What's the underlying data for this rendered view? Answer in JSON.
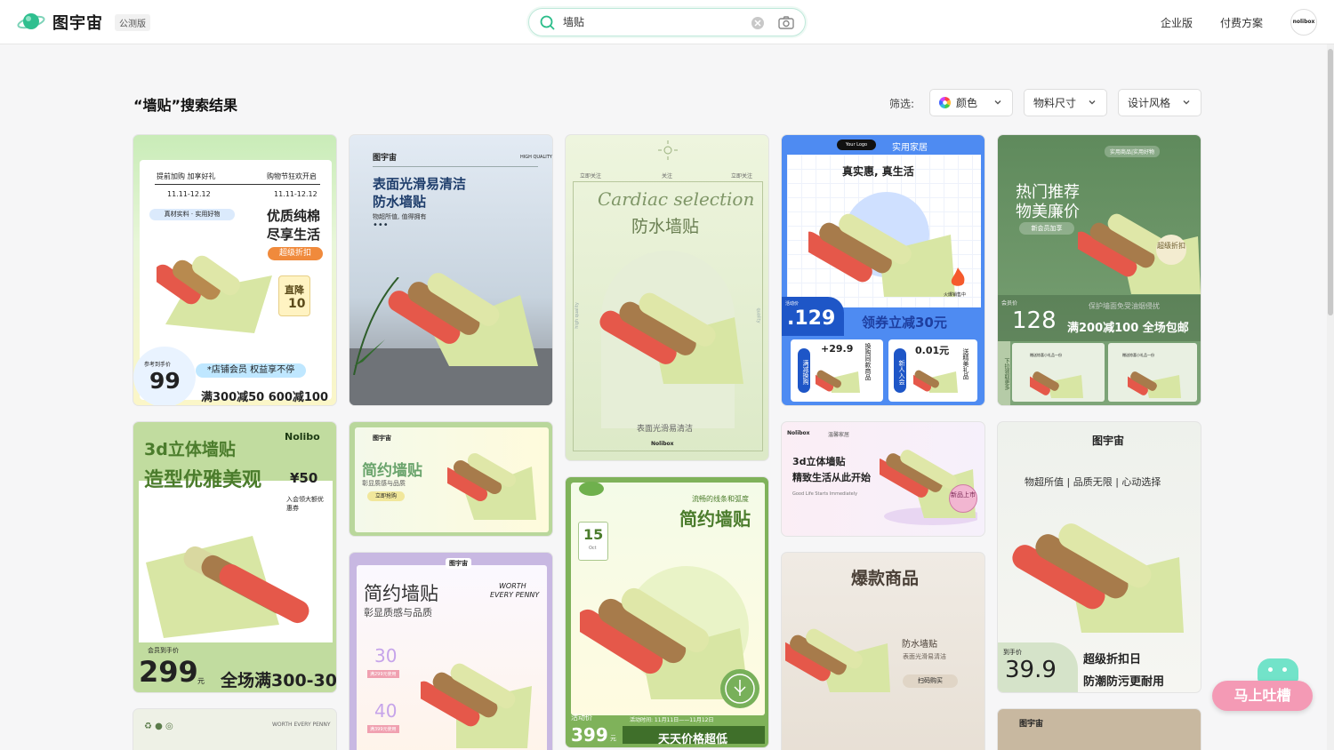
{
  "app": {
    "brand": "图宇宙",
    "badge": "公测版"
  },
  "search": {
    "value": "墙贴"
  },
  "nav": {
    "enterprise": "企业版",
    "pricing": "付费方案",
    "avatar": "nolibox"
  },
  "results": {
    "title": "“墙贴”搜索结果",
    "filter_label": "筛选:",
    "filters": [
      "颜色",
      "物料尺寸",
      "设计风格"
    ]
  },
  "colors": {
    "accent": "#2bbd8a",
    "feedback": "#f49ab5",
    "mascot": "#72e3c9"
  },
  "icons": [
    "planet-logo-icon",
    "search-icon",
    "clear-icon",
    "camera-icon",
    "color-wheel-icon",
    "chevron-down-icon",
    "mascot-icon"
  ],
  "cards": {
    "c1": {
      "t1": "提前加购 加享好礼",
      "t2": "购物节狂欢开启",
      "d1": "11.11-12.12",
      "d2": "11.11-12.12",
      "tag1": "真材实料",
      "tag2": "实用好物",
      "h1": "优质纯棉",
      "h2": "尽享生活",
      "badge": "超级折扣",
      "drop": "直降",
      "drop_val": "10",
      "ref": "参考到手价",
      "price": "99",
      "member": "*店铺会员 权益享不停",
      "promo": "满300减50 600减100"
    },
    "c2": {
      "logo": "图宇宙",
      "corner": "HIGH QUALITY",
      "h1": "表面光滑易清洁",
      "h2": "防水墙贴",
      "sub": "物超所值, 值得拥有",
      "dots": "•••"
    },
    "c3": {
      "n1": "立即关注",
      "n2": "关注",
      "n3": "立即关注",
      "script": "Cardiac selection",
      "h": "防水墙贴",
      "side1": "high quality",
      "side2": "quality",
      "foot": "表面光滑易清洁",
      "logo": "Nolibox"
    },
    "c4": {
      "logo": "Your Logo",
      "cat": "实用家居",
      "h": "真实惠, 真生活",
      "hot": "火爆销售中",
      "act": "活动价",
      "price": ".129",
      "coupon": "领券立减30元",
      "b1": "满减换购",
      "b1p": "+29.9",
      "b1s": "换购同款商品",
      "b2": "新人入会",
      "b2p": "0.01元",
      "b2s": "送精美礼品"
    },
    "c5": {
      "tags": "实用商品|实用好物",
      "h1": "热门推荐",
      "h2": "物美廉价",
      "new": "新会员加享",
      "badge": "超级折扣",
      "bar": "保护墙面免受油烟侵扰",
      "ref": "会员价",
      "price": "128",
      "promo": "满200减100 全场包邮",
      "side": "下拉领取更多",
      "g1": "赠送惊喜小礼品一份",
      "g2": "赠送惊喜小礼品一份"
    },
    "c6": {
      "h1": "3d立体墙贴",
      "h2": "造型优雅美观",
      "logo": "Nolibo",
      "coupon": "¥50",
      "coupon_sub": "入会领大额优惠券",
      "ref": "会员到手价",
      "price": "299",
      "unit": "元",
      "promo": "全场满300-30"
    },
    "c7": {
      "logo": "图宇宙",
      "h": "简约墙贴",
      "sub": "彰显质感与品质",
      "btn": "立即抢购"
    },
    "c8": {
      "logo": "图宇宙",
      "h": "简约墙贴",
      "sub": "彰显质感与品质",
      "worth": "WORTH",
      "worth2": "EVERY PENNY",
      "c1": "30",
      "c1s": "满299元使用",
      "c2": "40",
      "c2s": "满399元使用"
    },
    "c9": {
      "kicker": "流畅的线条和弧度",
      "h": "简约墙贴",
      "date": "15",
      "date_s": "Oct",
      "act": "活动价",
      "price": "399",
      "unit": "元",
      "time": "活动时间: 11月11日——11月12日",
      "promo": "天天价格超低"
    },
    "c10": {
      "logo": "Nolibox",
      "cat": "温馨家居",
      "h1": "3d立体墙贴",
      "h2": "精致生活从此开始",
      "sub": "Good Life Starts Immediately",
      "badge": "新品上市"
    },
    "c11": {
      "h": "爆款商品",
      "p1": "防水墙贴",
      "p2": "表面光滑易清洁",
      "btn": "扫码购买"
    },
    "c12": {
      "logo": "图宇宙",
      "sub": "物超所值 | 品质无限 | 心动选择",
      "ref": "到手价",
      "price": "39.9",
      "h1": "超级折扣日",
      "h2": "防潮防污更耐用"
    },
    "c13": {
      "worth": "WORTH EVERY PENNY"
    },
    "c14": {
      "logo": "图宇宙"
    }
  },
  "feedback": {
    "label": "马上吐槽"
  }
}
